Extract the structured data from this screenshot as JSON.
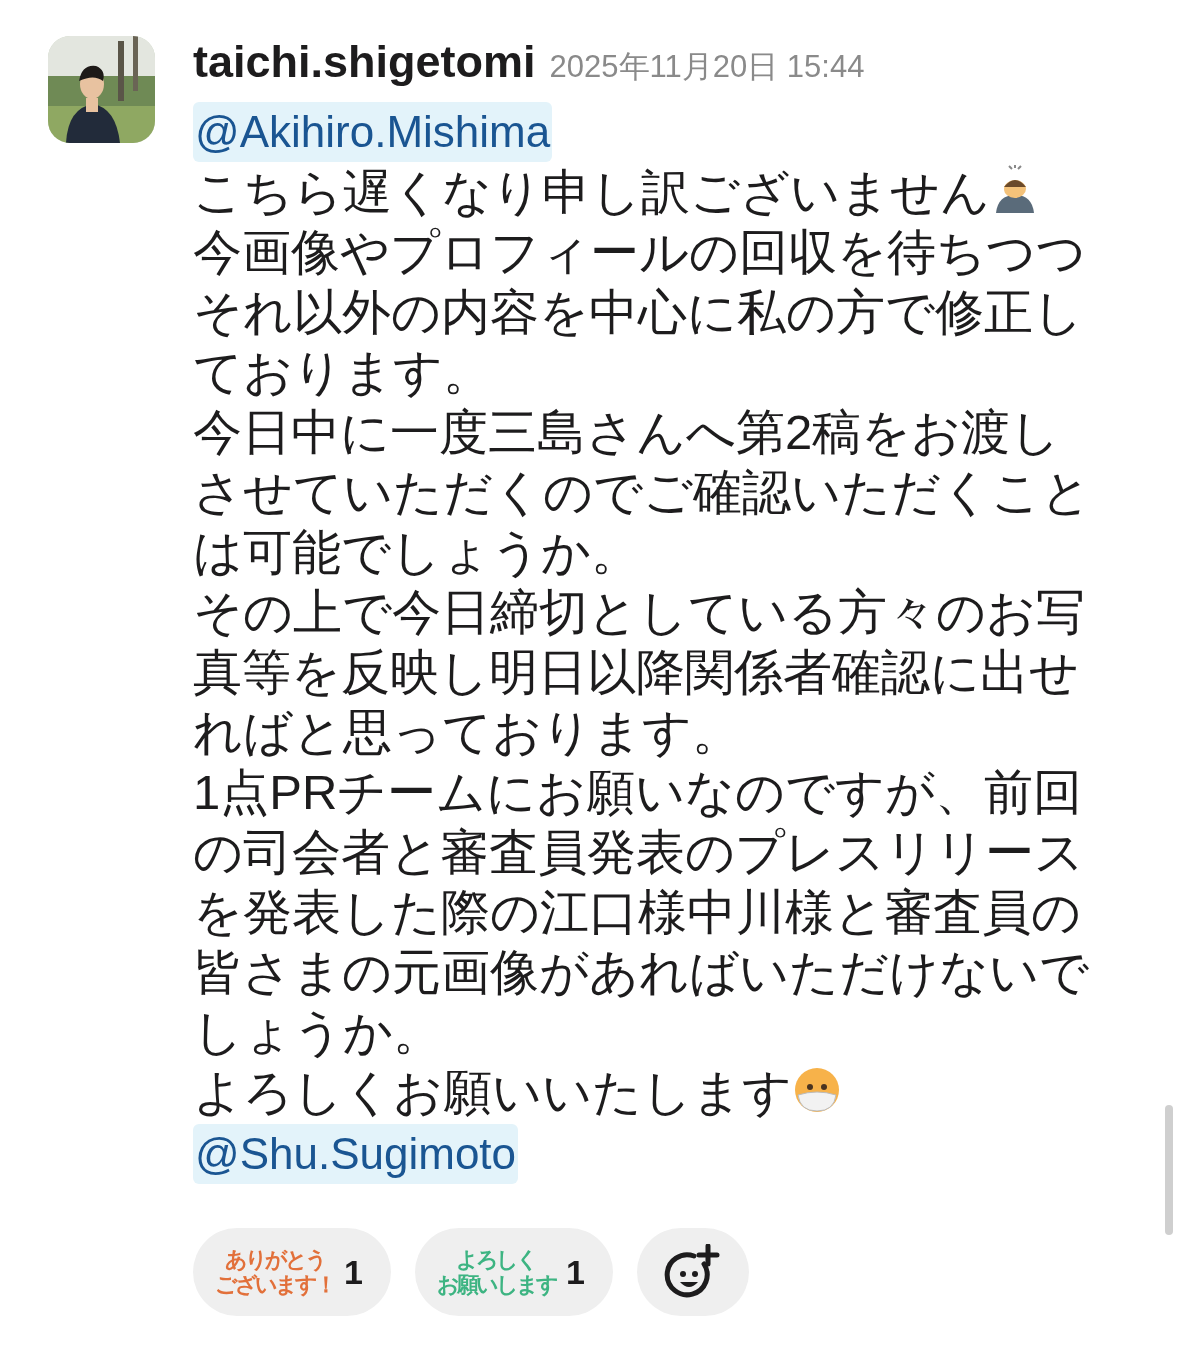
{
  "message": {
    "author": "taichi.shigetomi",
    "timestamp": "2025年11月20日 15:44",
    "blocks": [
      {
        "kind": "mention",
        "text": "@Akihiro.Mishima"
      },
      {
        "kind": "text",
        "text": "こちら遅くなり申し訳ございません",
        "end_icon": {
          "kind": "bow"
        }
      },
      {
        "kind": "text",
        "text": "今画像やプロフィールの回収を待ちつつそれ以外の内容を中心に私の方で修正しております。"
      },
      {
        "kind": "text",
        "text": "今日中に一度三島さんへ第2稿をお渡しさせていただくのでご確認いただくことは可能でしょうか。"
      },
      {
        "kind": "text",
        "text": "その上で今日締切としている方々のお写真等を反映し明日以降関係者確認に出せればと思っております。"
      },
      {
        "kind": "text",
        "text": "1点PRチームにお願いなのですが、前回の司会者と審査員発表のプレスリリースを発表した際の江口様中川様と審査員の皆さまの元画像があればいただけないでしょうか。"
      },
      {
        "kind": "text",
        "text": "よろしくお願いいたします",
        "end_icon": {
          "kind": "mask"
        }
      },
      {
        "kind": "mention",
        "text": "@Shu.Sugimoto"
      }
    ],
    "reactions": [
      {
        "lines": [
          "ありがとう",
          "ございます！"
        ],
        "color": "#e2703a",
        "count": "1"
      },
      {
        "lines": [
          "よろしく",
          "お願いします"
        ],
        "color": "#3db482",
        "count": "1"
      }
    ]
  }
}
